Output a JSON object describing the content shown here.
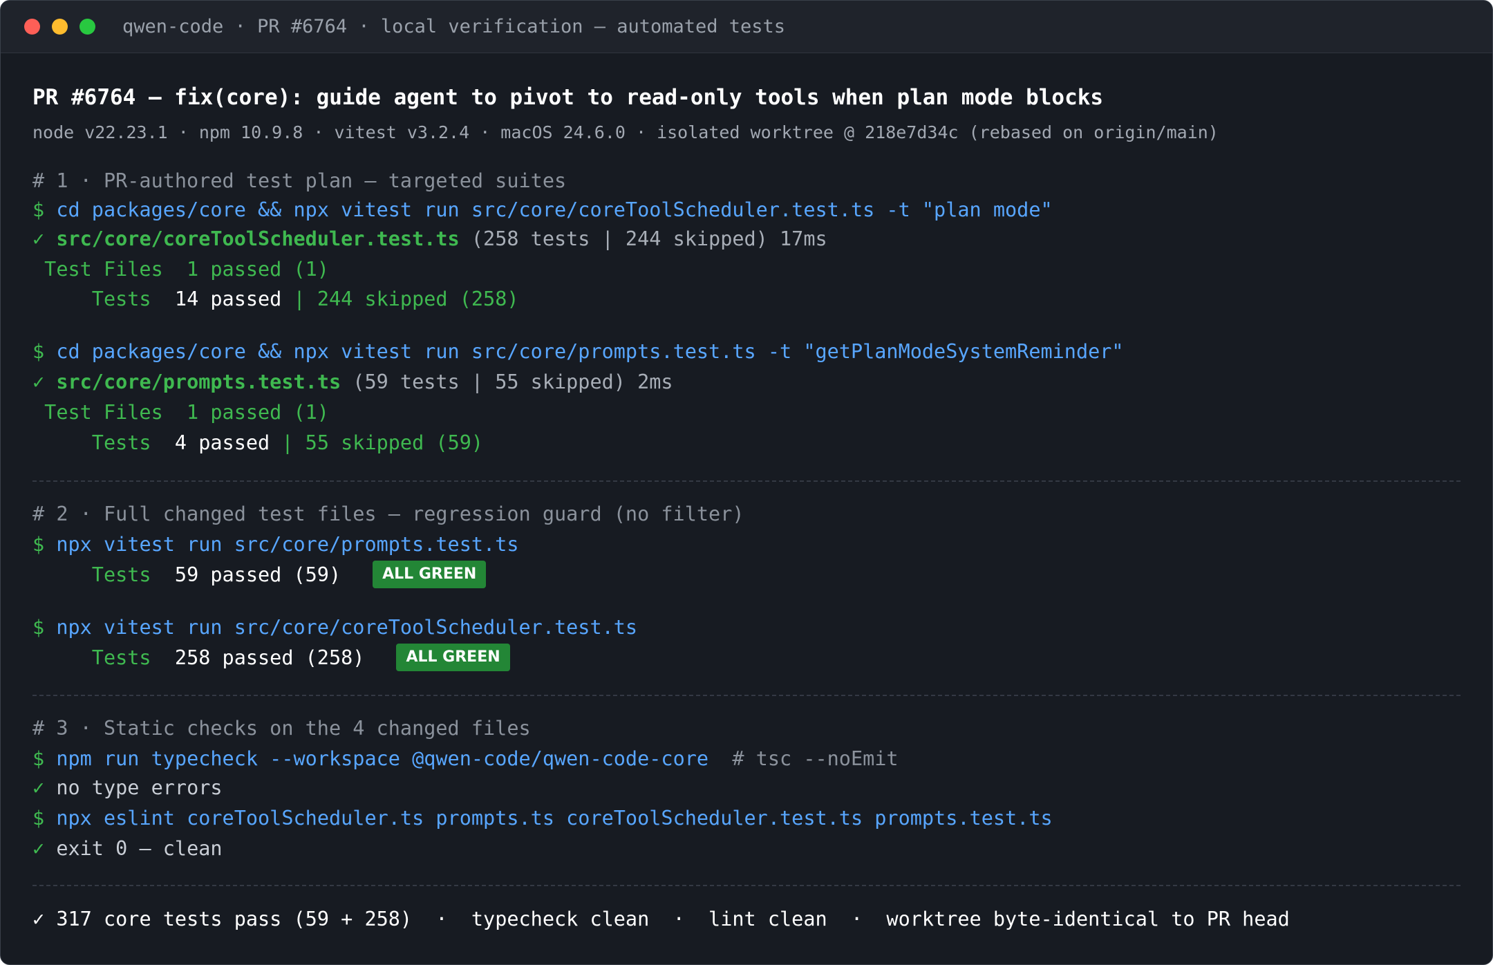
{
  "window": {
    "title": "qwen-code · PR #6764 · local verification — automated tests"
  },
  "header": {
    "title": "PR #6764 — fix(core): guide agent to pivot to read-only tools when plan mode blocks",
    "meta": "node v22.23.1 · npm 10.9.8 · vitest v3.2.4 · macOS 24.6.0 · isolated worktree @ 218e7d34c (rebased on origin/main)"
  },
  "section1": {
    "heading": "# 1 · PR-authored test plan — targeted suites",
    "run1": {
      "prompt": "$",
      "command": " cd packages/core && npx vitest run src/core/coreToolScheduler.test.ts -t \"plan mode\"",
      "check": "✓",
      "file": " src/core/coreToolScheduler.test.ts",
      "summary": " (258 tests | 244 skipped) 17ms",
      "files_label": " Test Files  1 passed (1)",
      "tests_label": "     Tests  ",
      "tests_passed": "14 passed",
      "tests_rest": " | 244 skipped (258)"
    },
    "run2": {
      "prompt": "$",
      "command": " cd packages/core && npx vitest run src/core/prompts.test.ts -t \"getPlanModeSystemReminder\"",
      "check": "✓",
      "file": " src/core/prompts.test.ts",
      "summary": " (59 tests | 55 skipped) 2ms",
      "files_label": " Test Files  1 passed (1)",
      "tests_label": "     Tests  ",
      "tests_passed": "4 passed",
      "tests_rest": " | 55 skipped (59)"
    }
  },
  "section2": {
    "heading": "# 2 · Full changed test files — regression guard (no filter)",
    "run1": {
      "prompt": "$",
      "command": " npx vitest run src/core/prompts.test.ts",
      "tests_label": "     Tests  ",
      "tests_result": "59 passed (59)",
      "badge": "ALL GREEN"
    },
    "run2": {
      "prompt": "$",
      "command": " npx vitest run src/core/coreToolScheduler.test.ts",
      "tests_label": "     Tests  ",
      "tests_result": "258 passed (258)",
      "badge": "ALL GREEN"
    }
  },
  "section3": {
    "heading": "# 3 · Static checks on the 4 changed files",
    "typecheck": {
      "prompt": "$",
      "command": " npm run typecheck --workspace @qwen-code/qwen-code-core",
      "comment": "  # tsc --noEmit",
      "check": "✓",
      "result": " no type errors"
    },
    "lint": {
      "prompt": "$",
      "command": " npx eslint coreToolScheduler.ts prompts.ts coreToolScheduler.test.ts prompts.test.ts",
      "check": "✓",
      "result": " exit 0 — clean"
    }
  },
  "footer": {
    "check": "✓",
    "summary": " 317 core tests pass (59 + 258)  ·  typecheck clean  ·  lint clean  ·  worktree byte-identical to PR head"
  }
}
